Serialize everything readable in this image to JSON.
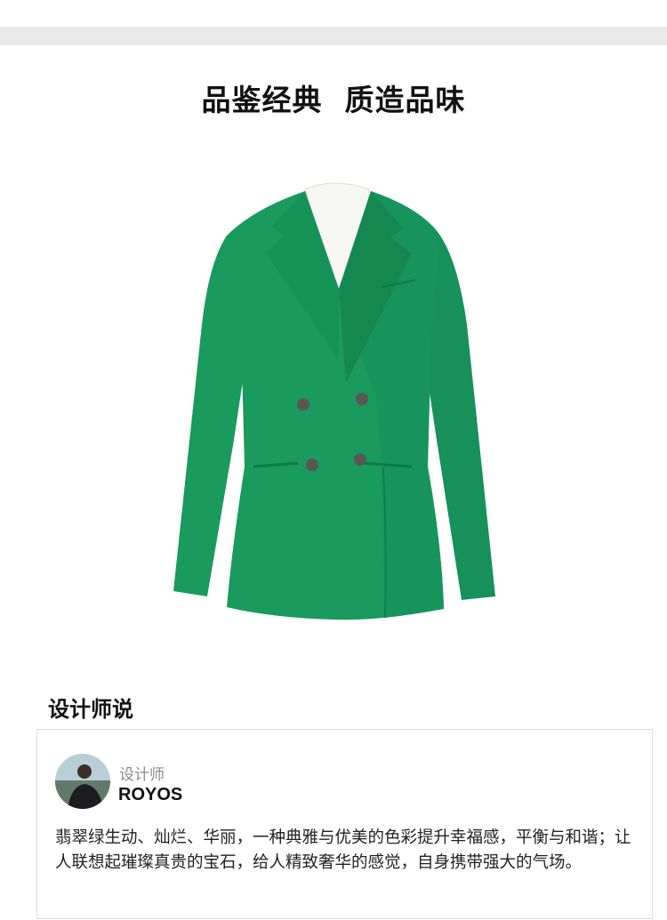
{
  "page": {
    "headline": "品鉴经典  质造品味"
  },
  "product": {
    "image_icon": "green-double-breasted-blazer",
    "colors": {
      "jacket": "#1a9a5c",
      "jacket_shadow": "#12804a",
      "shirt": "#f6f6f4",
      "buttons": "#5a5654"
    }
  },
  "designer_section": {
    "title": "设计师说",
    "card": {
      "role": "设计师",
      "name": "ROYOS",
      "quote": "翡翠绿生动、灿烂、华丽，一种典雅与优美的色彩提升幸福感，平衡与和谐；让人联想起璀璨真贵的宝石，给人精致奢华的感觉，自身携带强大的气场。"
    }
  }
}
